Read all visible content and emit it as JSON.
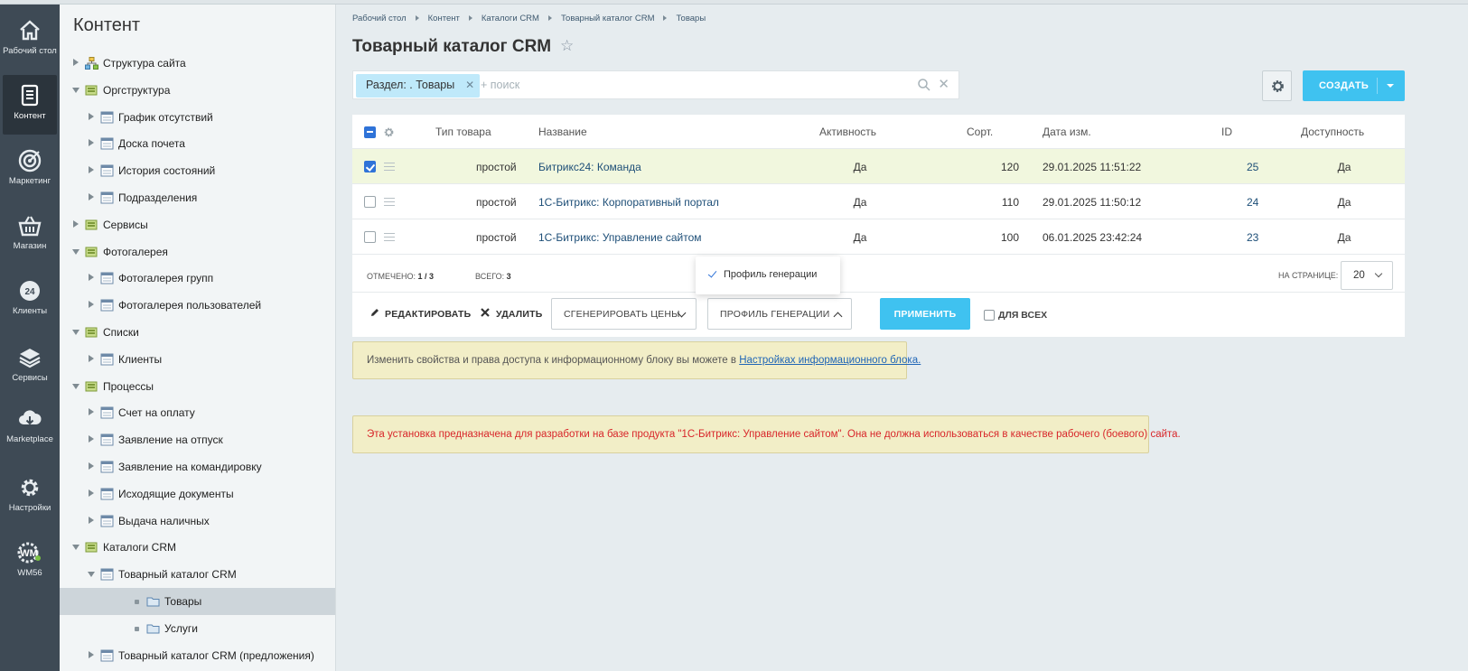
{
  "rail": [
    {
      "icon": "home-icon",
      "label": "Рабочий стол"
    },
    {
      "icon": "document-icon",
      "label": "Контент",
      "active": true
    },
    {
      "icon": "target-icon",
      "label": "Маркетинг"
    },
    {
      "icon": "basket-icon",
      "label": "Магазин"
    },
    {
      "icon": "clients-24-icon",
      "label": "Клиенты",
      "badge": "24"
    },
    {
      "icon": "layers-icon",
      "label": "Сервисы"
    },
    {
      "icon": "cloud-download-icon",
      "label": "Marketplace"
    },
    {
      "icon": "gear-icon",
      "label": "Настройки"
    },
    {
      "icon": "wm-logo-icon",
      "label": "WM56"
    }
  ],
  "tree": {
    "title": "Контент",
    "items": [
      {
        "label": "Структура сайта",
        "level": 0,
        "state": "collapsed",
        "icon": "site-structure-icon"
      },
      {
        "label": "Оргструктура",
        "level": 0,
        "state": "expanded",
        "icon": "iblock-type-icon"
      },
      {
        "label": "График отсутствий",
        "level": 1,
        "state": "collapsed",
        "icon": "iblock-icon"
      },
      {
        "label": "Доска почета",
        "level": 1,
        "state": "collapsed",
        "icon": "iblock-icon"
      },
      {
        "label": "История состояний",
        "level": 1,
        "state": "collapsed",
        "icon": "iblock-icon"
      },
      {
        "label": "Подразделения",
        "level": 1,
        "state": "collapsed",
        "icon": "iblock-icon"
      },
      {
        "label": "Сервисы",
        "level": 0,
        "state": "collapsed",
        "icon": "iblock-type-icon"
      },
      {
        "label": "Фотогалерея",
        "level": 0,
        "state": "expanded",
        "icon": "iblock-type-icon"
      },
      {
        "label": "Фотогалерея групп",
        "level": 1,
        "state": "collapsed",
        "icon": "iblock-icon"
      },
      {
        "label": "Фотогалерея пользователей",
        "level": 1,
        "state": "collapsed",
        "icon": "iblock-icon"
      },
      {
        "label": "Списки",
        "level": 0,
        "state": "expanded",
        "icon": "iblock-type-icon"
      },
      {
        "label": "Клиенты",
        "level": 1,
        "state": "collapsed",
        "icon": "iblock-icon"
      },
      {
        "label": "Процессы",
        "level": 0,
        "state": "expanded",
        "icon": "iblock-type-icon"
      },
      {
        "label": "Счет на оплату",
        "level": 1,
        "state": "collapsed",
        "icon": "iblock-icon"
      },
      {
        "label": "Заявление на отпуск",
        "level": 1,
        "state": "collapsed",
        "icon": "iblock-icon"
      },
      {
        "label": "Заявление на командировку",
        "level": 1,
        "state": "collapsed",
        "icon": "iblock-icon"
      },
      {
        "label": "Исходящие документы",
        "level": 1,
        "state": "collapsed",
        "icon": "iblock-icon"
      },
      {
        "label": "Выдача наличных",
        "level": 1,
        "state": "collapsed",
        "icon": "iblock-icon"
      },
      {
        "label": "Каталоги CRM",
        "level": 0,
        "state": "expanded",
        "icon": "iblock-type-icon"
      },
      {
        "label": "Товарный каталог CRM",
        "level": 1,
        "state": "expanded",
        "icon": "iblock-icon"
      },
      {
        "label": "Товары",
        "level": 2,
        "state": "leaf",
        "icon": "folder-icon",
        "selected": true
      },
      {
        "label": "Услуги",
        "level": 2,
        "state": "leaf",
        "icon": "folder-icon"
      },
      {
        "label": "Товарный каталог CRM (предложения)",
        "level": 1,
        "state": "collapsed",
        "icon": "iblock-icon"
      }
    ]
  },
  "breadcrumb": [
    "Рабочий стол",
    "Контент",
    "Каталоги CRM",
    "Товарный каталог CRM",
    "Товары"
  ],
  "page_title": "Товарный каталог CRM",
  "filter": {
    "chip_label": "Раздел: . Товары",
    "placeholder": "+ поиск"
  },
  "create_button": "СОЗДАТЬ",
  "grid": {
    "columns": {
      "type": "Тип товара",
      "name": "Название",
      "active": "Активность",
      "sort": "Сорт.",
      "date": "Дата изм.",
      "id": "ID",
      "avail": "Доступность"
    },
    "rows": [
      {
        "checked": true,
        "type": "простой",
        "name": "Битрикс24: Команда",
        "active": "Да",
        "sort": "120",
        "date": "29.01.2025 11:51:22",
        "id": "25",
        "avail": "Да"
      },
      {
        "checked": false,
        "type": "простой",
        "name": "1С-Битрикс: Корпоративный портал",
        "active": "Да",
        "sort": "110",
        "date": "29.01.2025 11:50:12",
        "id": "24",
        "avail": "Да"
      },
      {
        "checked": false,
        "type": "простой",
        "name": "1С-Битрикс: Управление сайтом",
        "active": "Да",
        "sort": "100",
        "date": "06.01.2025 23:42:24",
        "id": "23",
        "avail": "Да"
      }
    ],
    "footer": {
      "selected_label": "ОТМЕЧЕНО:",
      "selected_value": "1 / 3",
      "total_label": "ВСЕГО:",
      "total_value": "3",
      "per_page_label": "НА СТРАНИЦЕ:",
      "per_page_value": "20"
    },
    "actions": {
      "edit": "РЕДАКТИРОВАТЬ",
      "delete": "УДАЛИТЬ",
      "generate_prices": "СГЕНЕРИРОВАТЬ ЦЕНЫ",
      "generation_profile": "ПРОФИЛЬ ГЕНЕРАЦИИ",
      "apply": "ПРИМЕНИТЬ",
      "for_all": "ДЛЯ ВСЕХ"
    },
    "popup_option": "Профиль генерации"
  },
  "notices": {
    "info_text": "Изменить свойства и права доступа к информационному блоку вы можете в",
    "info_link": "Настройках информационного блока.",
    "warning_text": "Эта установка предназначена для разработки на базе продукта \"1С-Битрикс: Управление сайтом\". Она не должна использоваться в качестве рабочего (боевого) сайта."
  },
  "colors": {
    "accent": "#3fc2f0",
    "rail_bg": "#3e4a55",
    "link": "#1d4e77",
    "checked_row": "#f1f7de",
    "warning_text": "#d8262a",
    "notice_bg": "#f2eec7"
  }
}
